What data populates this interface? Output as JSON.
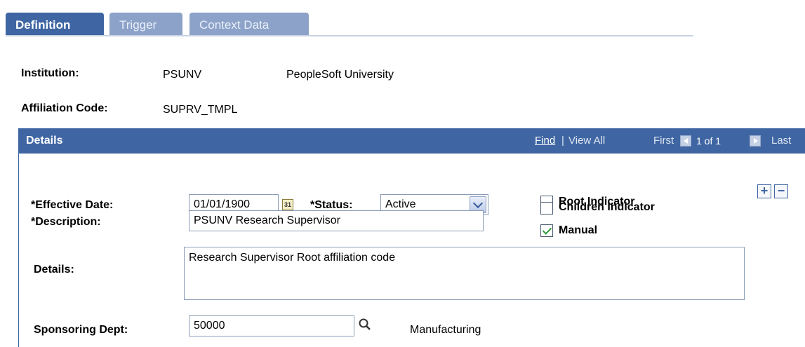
{
  "tabs": [
    {
      "label": "Definition",
      "active": true
    },
    {
      "label": "Trigger",
      "active": false
    },
    {
      "label": "Context Data",
      "active": false
    }
  ],
  "header": {
    "institution_label": "Institution:",
    "institution_code": "PSUNV",
    "institution_name": "PeopleSoft University",
    "affiliation_label": "Affiliation Code:",
    "affiliation_code": "SUPRV_TMPL"
  },
  "details_grid": {
    "title": "Details",
    "find_label": "Find",
    "view_all_label": "View All",
    "first_label": "First",
    "counter": "1 of 1",
    "last_label": "Last"
  },
  "form": {
    "effective_date_label": "*Effective Date:",
    "effective_date_value": "01/01/1900",
    "calendar_icon_text": "31",
    "status_label": "*Status:",
    "status_value": "Active",
    "description_label": "*Description:",
    "description_value": "PSUNV Research Supervisor",
    "details_label": "Details:",
    "details_value": "Research Supervisor Root affiliation code",
    "sponsoring_dept_label": "Sponsoring Dept:",
    "sponsoring_dept_value": "50000",
    "sponsoring_dept_name": "Manufacturing",
    "root_indicator_label": "Root Indicator",
    "root_indicator_checked": false,
    "children_indicator_label": "Children Indicator",
    "children_indicator_checked": false,
    "manual_label": "Manual",
    "manual_checked": true
  },
  "colors": {
    "accent": "#3f66a3",
    "inactive_tab": "#8ca2c8",
    "check": "#2f9a3a"
  }
}
